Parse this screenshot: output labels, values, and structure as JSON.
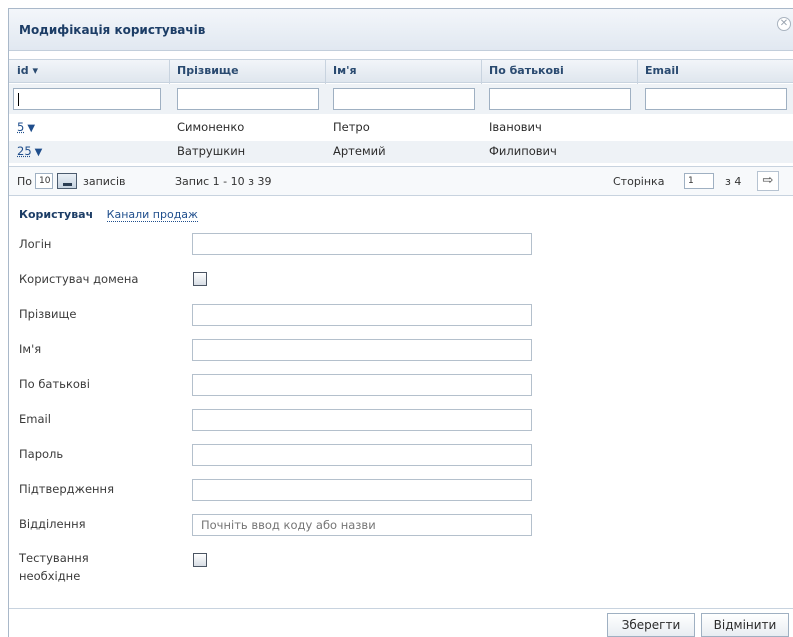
{
  "dialog": {
    "title": "Модифікація користувачів",
    "close_icon": "close-icon"
  },
  "grid": {
    "columns": [
      "id ▾",
      "Прізвище",
      "Ім'я",
      "По батькові",
      "Email"
    ],
    "rows": [
      {
        "id": "5",
        "surname": "Симоненко",
        "name": "Петро",
        "patronymic": "Іванович",
        "email": ""
      },
      {
        "id": "25",
        "surname": "Ватрушкин",
        "name": "Артемий",
        "patronymic": "Филипович",
        "email": ""
      }
    ],
    "row_menu_icon": "chevron-down-icon"
  },
  "pager": {
    "per_prefix": "По",
    "per_value": "10",
    "per_suffix": "записів",
    "range": "Запис 1 - 10 з 39",
    "page_label": "Сторінка",
    "page_value": "1",
    "page_of": "з 4",
    "next_icon": "arrow-right-icon"
  },
  "tabs": {
    "active": "Користувач",
    "other": "Канали продаж"
  },
  "form": {
    "login": "Логін",
    "domain_user": "Користувач домена",
    "surname": "Прізвище",
    "name": "Ім'я",
    "patronymic": "По батькові",
    "email": "Email",
    "password": "Пароль",
    "confirm": "Підтвердження",
    "department": "Відділення",
    "department_placeholder": "Почніть ввод коду або назви",
    "testing_line1": "Тестування",
    "testing_line2": "необхідне"
  },
  "buttons": {
    "save": "Зберегти",
    "cancel": "Відмінити"
  }
}
